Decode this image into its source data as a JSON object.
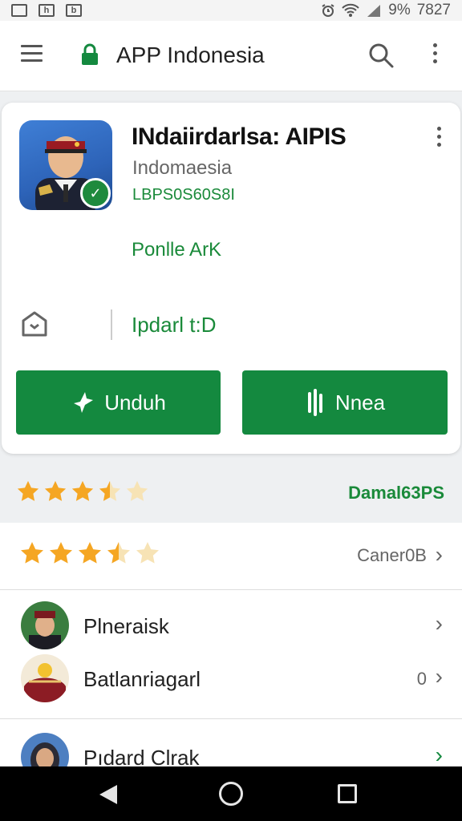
{
  "status_bar": {
    "battery": "9%",
    "time": "7827",
    "left_icon_letters": [
      "",
      "h",
      "b"
    ]
  },
  "app_bar": {
    "title": "APP Indonesia",
    "menu_icon": "hamburger-icon",
    "lock_icon": "lock-icon",
    "search_icon": "search-icon",
    "more_icon": "more-vert-icon"
  },
  "app": {
    "name": "INdaiirdarlsa: AIPIS",
    "developer": "Indomaesia",
    "code": "LBPS0S60S8I",
    "tag": "Ponlle ArK",
    "update": "Ipdarl t:D",
    "buttons": {
      "download": "Unduh",
      "open": "Nnea"
    },
    "accent_color": "#14893f"
  },
  "rating_strip": {
    "stars": 3.5,
    "label": "Damal63PS"
  },
  "list": {
    "rating_row": {
      "stars": 3.5,
      "right_text": "Caner0B"
    },
    "people": [
      {
        "name": "Plneraisk",
        "right_text": ""
      },
      {
        "name": "Batlanriagarl",
        "right_text": "0"
      },
      {
        "name": "Pıdard Clrak",
        "right_text": ""
      }
    ]
  },
  "nav_bar": {
    "back_icon": "back-triangle-icon",
    "home_icon": "home-circle-icon",
    "recent_icon": "recent-square-icon"
  }
}
